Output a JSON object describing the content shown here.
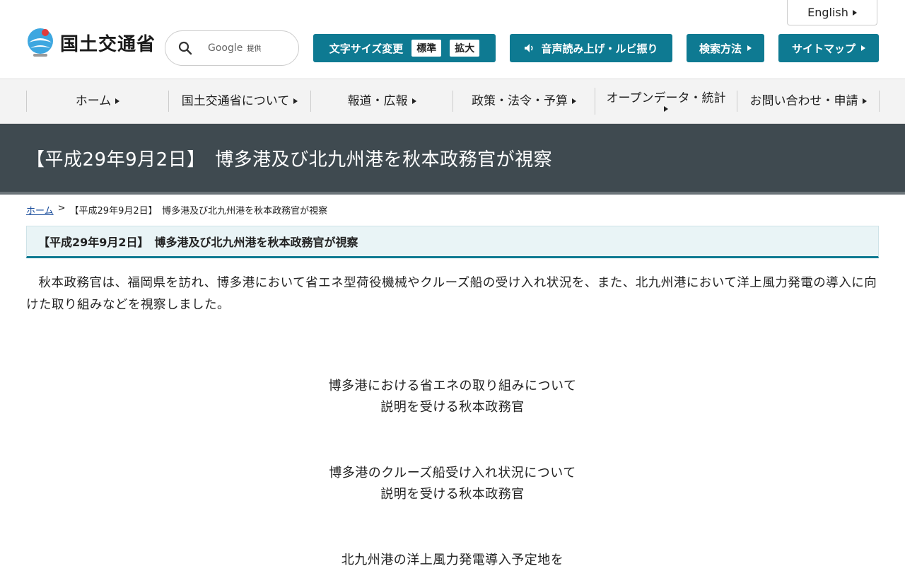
{
  "header": {
    "english_label": "English",
    "logo_text": "国土交通省",
    "search_provider": "Google",
    "search_provided": "提供",
    "font_size_label": "文字サイズ変更",
    "font_size_standard": "標準",
    "font_size_large": "拡大",
    "reader_label": "音声読み上げ・ルビ振り",
    "search_method_label": "検索方法",
    "sitemap_label": "サイトマップ",
    "accent_color": "#0e7a92"
  },
  "nav": {
    "items": [
      {
        "label": "ホーム"
      },
      {
        "label": "国土交通省について"
      },
      {
        "label": "報道・広報"
      },
      {
        "label": "政策・法令・予算"
      },
      {
        "label": "オープンデータ・統計"
      },
      {
        "label": "お問い合わせ・申請"
      }
    ]
  },
  "page": {
    "title": "【平成29年9月2日】　博多港及び北九州港を秋本政務官が視察",
    "breadcrumb_home": "ホーム",
    "breadcrumb_sep": ">",
    "breadcrumb_current": "【平成29年9月2日】　博多港及び北九州港を秋本政務官が視察",
    "subheading": "【平成29年9月2日】　博多港及び北九州港を秋本政務官が視察",
    "body": "秋本政務官は、福岡県を訪れ、博多港において省エネ型荷役機械やクルーズ船の受け入れ状況を、また、北九州港において洋上風力発電の導入に向けた取り組みなどを視察しました。",
    "captions": [
      {
        "line1": "博多港における省エネの取り組みについて",
        "line2": "説明を受ける秋本政務官"
      },
      {
        "line1": "博多港のクルーズ船受け入れ状況について",
        "line2": "説明を受ける秋本政務官"
      },
      {
        "line1": "北九州港の洋上風力発電導入予定地を",
        "line2": ""
      }
    ]
  }
}
